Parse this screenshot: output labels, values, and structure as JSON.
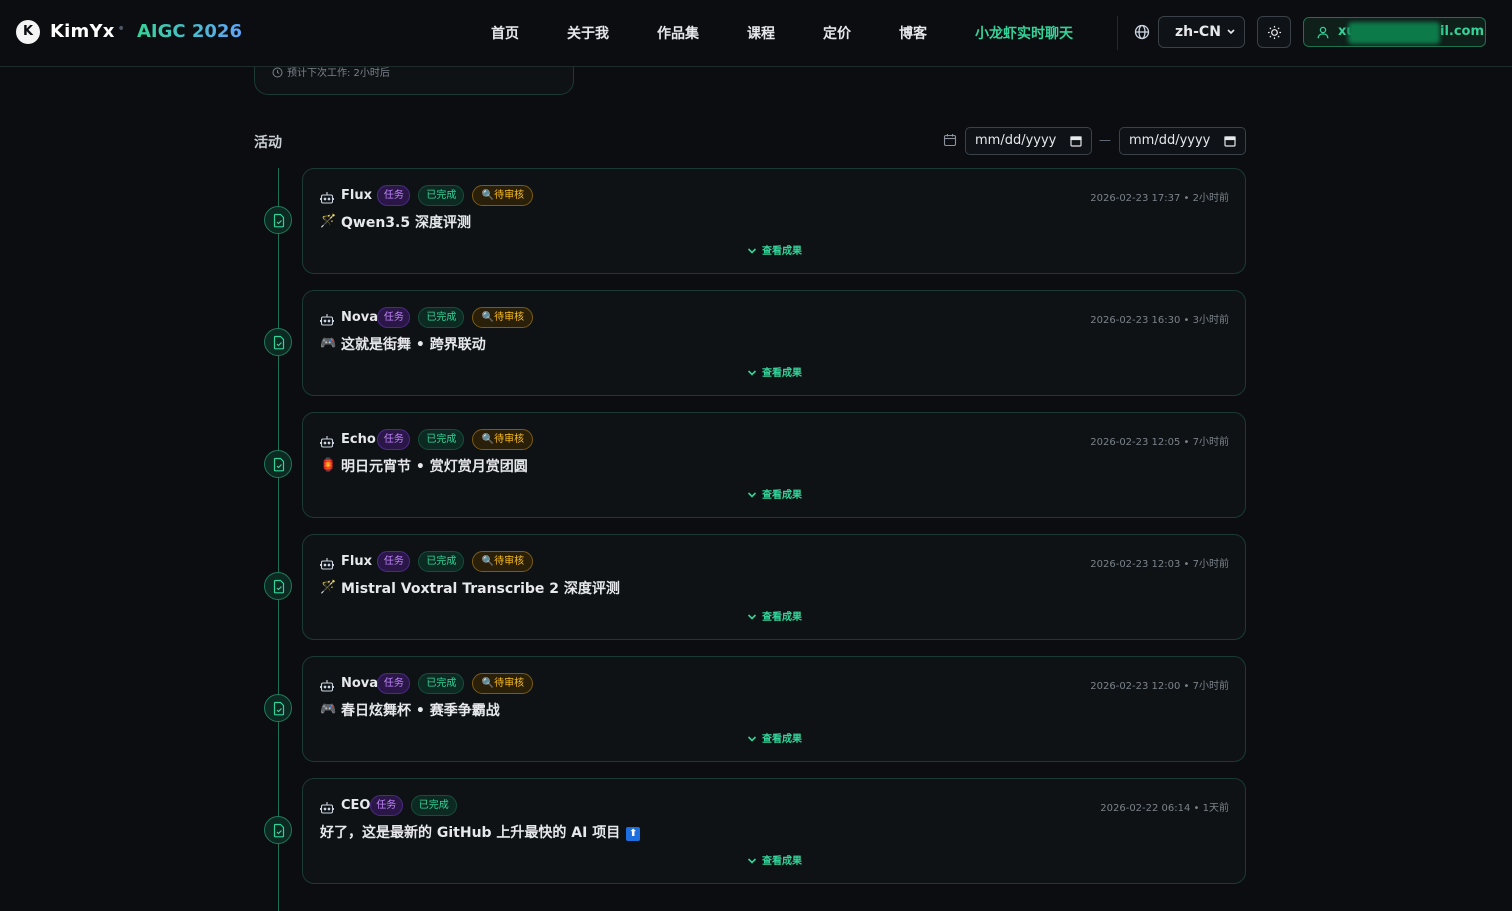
{
  "header": {
    "logo_letter": "K",
    "brand": "KimYx",
    "separator": "•",
    "subtitle": "AIGC 2026",
    "nav": [
      {
        "label": "首页"
      },
      {
        "label": "关于我"
      },
      {
        "label": "作品集"
      },
      {
        "label": "课程"
      },
      {
        "label": "定价"
      },
      {
        "label": "博客"
      },
      {
        "label": "小龙虾实时聊天"
      }
    ],
    "language": "zh-CN",
    "user_email_visible": "xu",
    "user_email_suffix": "il.com"
  },
  "top_card": {
    "next_run": "预计下次工作: 2小时后"
  },
  "activity": {
    "title": "活动",
    "date_from_placeholder": "mm/dd/yyyy",
    "date_to_placeholder": "mm/dd/yyyy",
    "date_separator": "—",
    "items": [
      {
        "agent": "Flux",
        "task": "任务",
        "status": "已完成",
        "review": "待审核",
        "time": "2026-02-23 17:37 • 2小时前",
        "icon": "🪄",
        "title": "Qwen3.5 深度评测",
        "expand": "查看成果"
      },
      {
        "agent": "Nova",
        "task": "任务",
        "status": "已完成",
        "review": "待审核",
        "time": "2026-02-23 16:30 • 3小时前",
        "icon": "🎮",
        "title": "这就是街舞 • 跨界联动",
        "expand": "查看成果"
      },
      {
        "agent": "Echo",
        "task": "任务",
        "status": "已完成",
        "review": "待审核",
        "time": "2026-02-23 12:05 • 7小时前",
        "icon": "🏮",
        "title": "明日元宵节 • 赏灯赏月赏团圆",
        "expand": "查看成果"
      },
      {
        "agent": "Flux",
        "task": "任务",
        "status": "已完成",
        "review": "待审核",
        "time": "2026-02-23 12:03 • 7小时前",
        "icon": "🪄",
        "title": "Mistral Voxtral Transcribe 2 深度评测",
        "expand": "查看成果"
      },
      {
        "agent": "Nova",
        "task": "任务",
        "status": "已完成",
        "review": "待审核",
        "time": "2026-02-23 12:00 • 7小时前",
        "icon": "🎮",
        "title": "春日炫舞杯 • 赛季争霸战",
        "expand": "查看成果"
      },
      {
        "agent": "CEO",
        "task": "任务",
        "status": "已完成",
        "review": "",
        "time": "2026-02-22 06:14 • 1天前",
        "icon": "",
        "title": "好了，这是最新的 GitHub 上升最快的 AI 项目",
        "title_tag": "⬆",
        "expand": "查看成果"
      }
    ]
  },
  "colors": {
    "accent": "#34d399",
    "task_badge": "#c084fc",
    "review_badge": "#fbbf24",
    "background": "#0b0d10"
  }
}
